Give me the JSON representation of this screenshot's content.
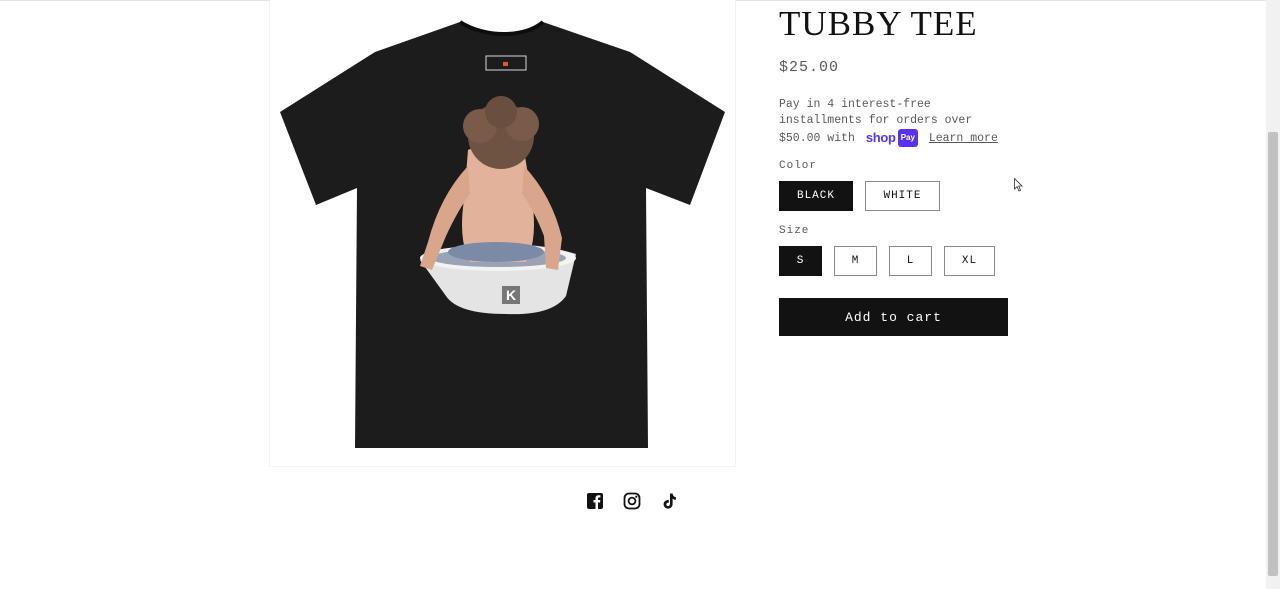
{
  "product": {
    "title": "TUBBY TEE",
    "price": "$25.00",
    "installments_text": "Pay in 4 interest-free installments for orders over $50.00 with",
    "shoppay_shop": "shop",
    "shoppay_pay": "Pay",
    "learn_more": "Learn more",
    "color_label": "Color",
    "colors": [
      "BLACK",
      "WHITE"
    ],
    "selected_color": "BLACK",
    "size_label": "Size",
    "sizes": [
      "S",
      "M",
      "L",
      "XL"
    ],
    "selected_size": "S",
    "add_to_cart": "Add to cart",
    "image_print_text": "K"
  },
  "social": [
    "facebook-icon",
    "instagram-icon",
    "tiktok-icon"
  ],
  "colors": {
    "primary": "#121212",
    "muted": "#5a5a5a",
    "shoppay": "#5a31f4"
  }
}
